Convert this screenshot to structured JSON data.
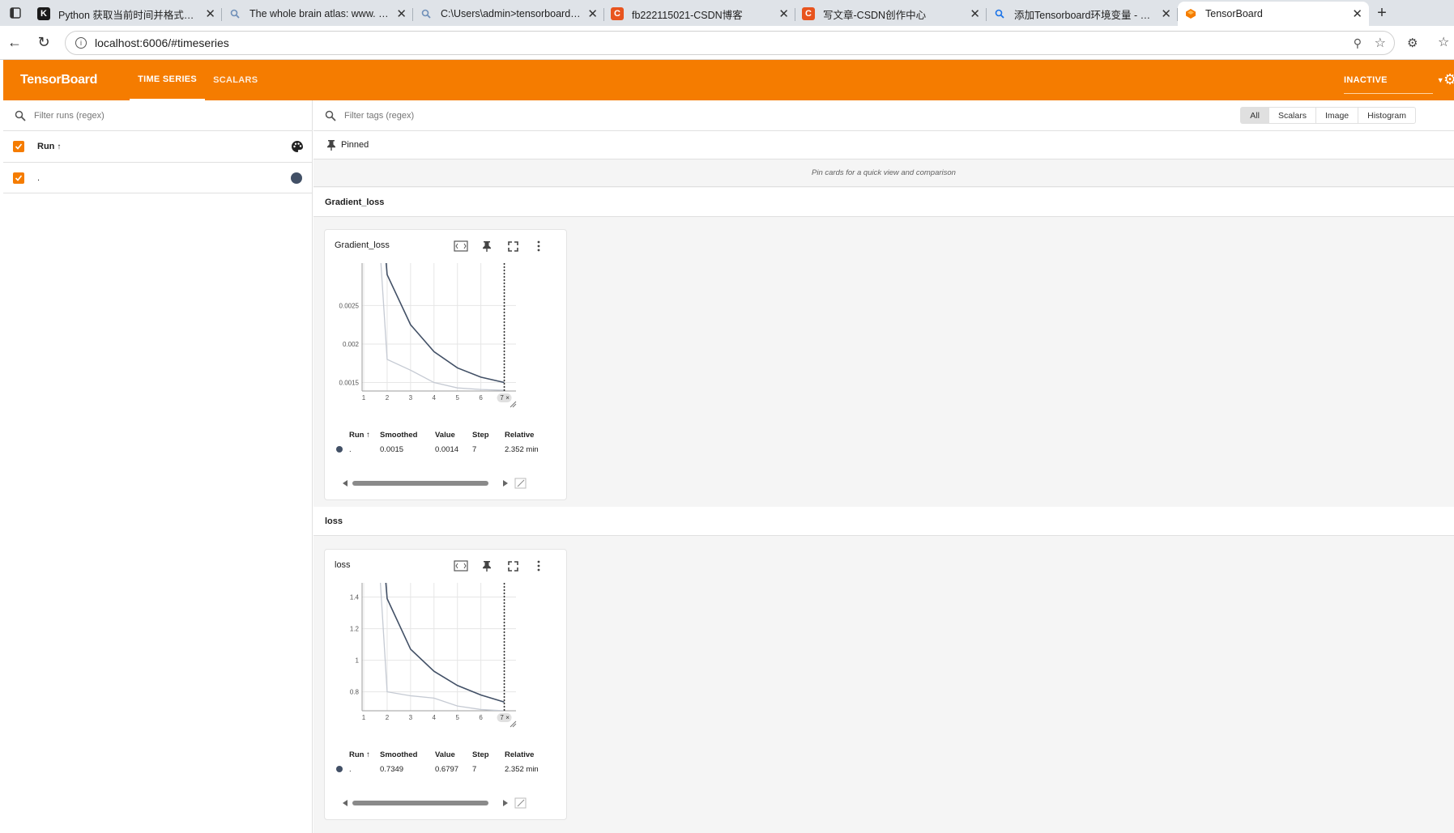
{
  "browser": {
    "tabs": [
      {
        "title": "Python 获取当前时间并格式化为",
        "favicon": "K",
        "color": "#1a1a1a"
      },
      {
        "title": "The whole brain atlas: www. med",
        "favicon": "search-icon",
        "color": "#6f8fb8"
      },
      {
        "title": "C:\\Users\\admin>tensorboard --lo",
        "favicon": "search-icon",
        "color": "#6f8fb8"
      },
      {
        "title": "fb222115021-CSDN博客",
        "favicon": "C",
        "color": "#e8541e"
      },
      {
        "title": "写文章-CSDN创作中心",
        "favicon": "C",
        "color": "#e8541e"
      },
      {
        "title": "添加Tensorboard环境变量 - 搜索",
        "favicon": "search-icon",
        "color": "#1a73e8"
      },
      {
        "title": "TensorBoard",
        "favicon": "tensorboard-icon",
        "color": "#f57c00",
        "active": true
      }
    ],
    "url": "localhost:6006/#timeseries"
  },
  "header": {
    "logo": "TensorBoard",
    "tabs": [
      "TIME SERIES",
      "SCALARS"
    ],
    "status": "INACTIVE"
  },
  "sidebar": {
    "filter_placeholder": "Filter runs (regex)",
    "run_header": "Run",
    "runs": [
      {
        "name": ".",
        "color": "#425066"
      }
    ]
  },
  "main": {
    "filter_placeholder": "Filter tags (regex)",
    "type_filters": [
      "All",
      "Scalars",
      "Image",
      "Histogram"
    ],
    "pinned_label": "Pinned",
    "pinned_hint": "Pin cards for a quick view and comparison",
    "groups": [
      "Gradient_loss",
      "loss"
    ]
  },
  "cards": [
    {
      "title": "Gradient_loss",
      "table_headers": [
        "Run",
        "Smoothed",
        "Value",
        "Step",
        "Relative"
      ],
      "row": {
        "run": ".",
        "smoothed": "0.0015",
        "value": "0.0014",
        "step": "7",
        "relative": "2.352 min"
      },
      "chart_data": {
        "type": "line",
        "x": [
          1,
          2,
          3,
          4,
          5,
          6,
          7
        ],
        "x_ticks": [
          "1",
          "2",
          "3",
          "4",
          "5",
          "6",
          "7"
        ],
        "y_ticks": [
          0.0015,
          0.002,
          0.0025
        ],
        "y_tick_labels": [
          "0.0015",
          "0.002",
          "0.0025"
        ],
        "ylim": [
          0.00139,
          0.00305
        ],
        "series": [
          {
            "role": "raw",
            "color": "#c5cad3",
            "values": [
              0.0065,
              0.0018,
              0.00166,
              0.0015,
              0.00143,
              0.00141,
              0.0014
            ]
          },
          {
            "role": "smoothed",
            "color": "#425066",
            "values": [
              0.0065,
              0.0029,
              0.00225,
              0.0019,
              0.00169,
              0.00157,
              0.0015
            ]
          }
        ]
      }
    },
    {
      "title": "loss",
      "table_headers": [
        "Run",
        "Smoothed",
        "Value",
        "Step",
        "Relative"
      ],
      "row": {
        "run": ".",
        "smoothed": "0.7349",
        "value": "0.6797",
        "step": "7",
        "relative": "2.352 min"
      },
      "chart_data": {
        "type": "line",
        "x": [
          1,
          2,
          3,
          4,
          5,
          6,
          7
        ],
        "x_ticks": [
          "1",
          "2",
          "3",
          "4",
          "5",
          "6",
          "7"
        ],
        "y_ticks": [
          0.8,
          1.0,
          1.2,
          1.4
        ],
        "y_tick_labels": [
          "0.8",
          "1",
          "1.2",
          "1.4"
        ],
        "ylim": [
          0.68,
          1.49
        ],
        "series": [
          {
            "role": "raw",
            "color": "#c5cad3",
            "values": [
              3.2,
              0.8,
              0.775,
              0.76,
              0.71,
              0.688,
              0.68
            ]
          },
          {
            "role": "smoothed",
            "color": "#425066",
            "values": [
              3.2,
              1.39,
              1.07,
              0.93,
              0.84,
              0.78,
              0.735
            ]
          }
        ]
      }
    }
  ]
}
